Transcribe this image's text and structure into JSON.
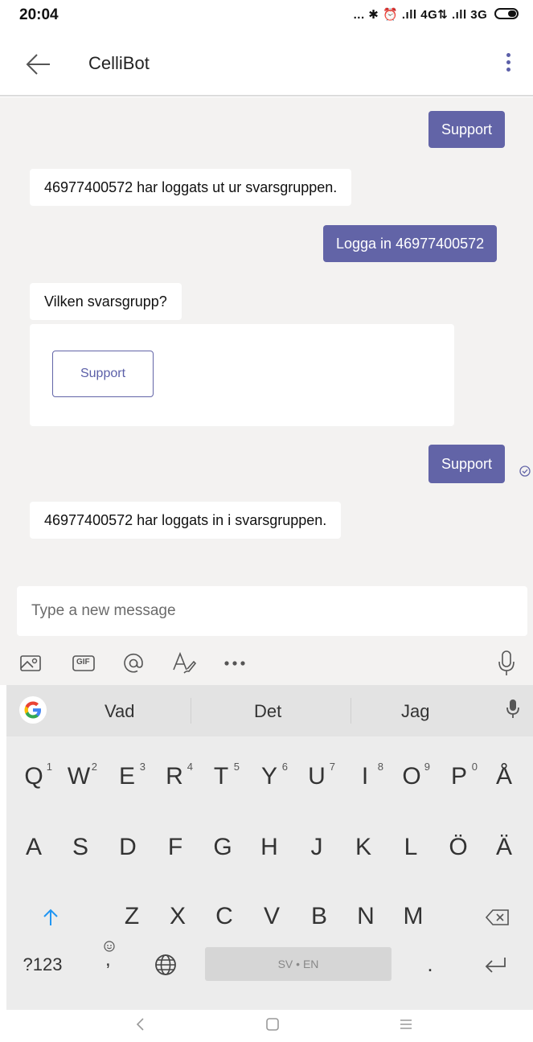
{
  "status_bar": {
    "time": "20:04",
    "icons_text": "... ✱ ⏰ .ıll 4G⇅ .ıll 3G"
  },
  "header": {
    "title": "CelliBot"
  },
  "chat": {
    "messages": [
      {
        "dir": "out",
        "text": "Support"
      },
      {
        "dir": "in",
        "text": "46977400572 har loggats ut ur svarsgruppen."
      },
      {
        "dir": "out",
        "text": "Logga in 46977400572"
      },
      {
        "dir": "in",
        "text": "Vilken svarsgrupp?"
      },
      {
        "dir": "out",
        "text": "Support"
      },
      {
        "dir": "in",
        "text": "46977400572 har loggats in i svarsgruppen."
      }
    ],
    "card_button": "Support"
  },
  "compose": {
    "placeholder": "Type a new message",
    "gif_label": "GIF",
    "tools": [
      "image-icon",
      "gif-icon",
      "mention-icon",
      "format-icon",
      "more-icon",
      "microphone-icon"
    ]
  },
  "keyboard": {
    "suggestions": [
      "Vad",
      "Det",
      "Jag"
    ],
    "row1": [
      "Q",
      "W",
      "E",
      "R",
      "T",
      "Y",
      "U",
      "I",
      "O",
      "P",
      "Å"
    ],
    "row1_digits": [
      "1",
      "2",
      "3",
      "4",
      "5",
      "6",
      "7",
      "8",
      "9",
      "0"
    ],
    "row2": [
      "A",
      "S",
      "D",
      "F",
      "G",
      "H",
      "J",
      "K",
      "L",
      "Ö",
      "Ä"
    ],
    "row3": [
      "Z",
      "X",
      "C",
      "V",
      "B",
      "N",
      "M"
    ],
    "sym_key": "?123",
    "emoji_sub": ",",
    "space_label": "SV • EN",
    "period": "."
  },
  "colors": {
    "accent": "#6264a7",
    "chat_bg": "#f3f2f1"
  }
}
